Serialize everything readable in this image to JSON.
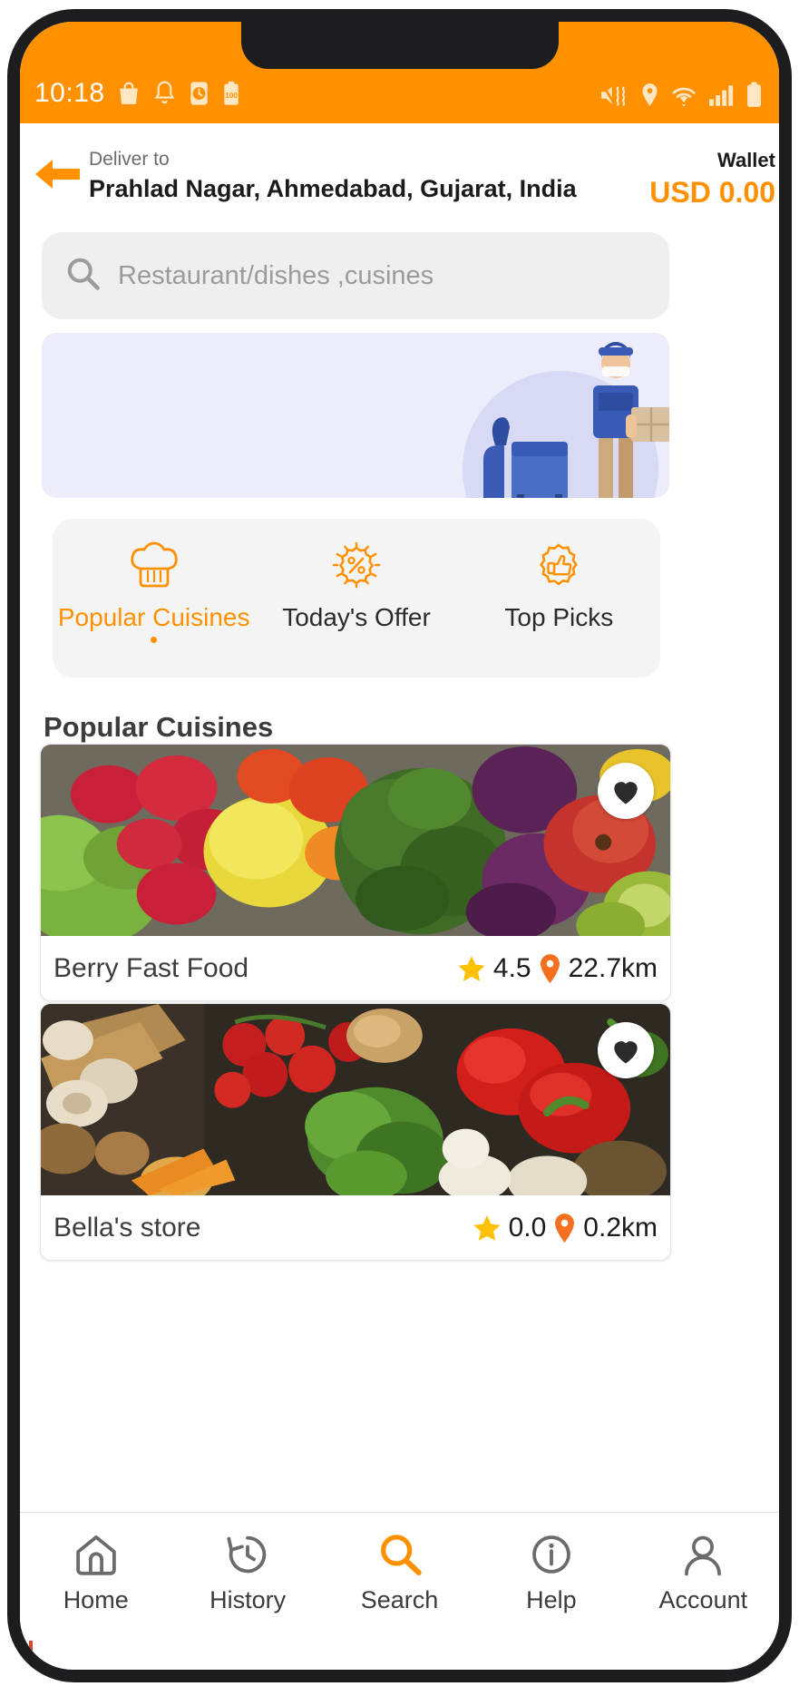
{
  "status_bar": {
    "time": "10:18",
    "left_icons": [
      "shopping-bag-icon",
      "bell-icon",
      "clock-icon",
      "battery-100-icon"
    ],
    "battery_text": "100",
    "right_icons": [
      "volume-mute-vibrate-icon",
      "location-pin-icon",
      "wifi-icon",
      "cellular-signal-icon",
      "battery-full-icon"
    ],
    "bg_color": "#FF9100"
  },
  "header": {
    "back_icon": "arrow-left-icon",
    "deliver_label": "Deliver to",
    "address": "Prahlad Nagar, Ahmedabad, Gujarat, India",
    "wallet_label": "Wallet",
    "wallet_amount": "USD 0.00",
    "accent_color": "#FF9100"
  },
  "search": {
    "icon": "search-icon",
    "placeholder": "Restaurant/dishes ,cusines",
    "value": ""
  },
  "banner": {
    "name": "delivery-person-illustration",
    "bg_color": "#ececfb"
  },
  "category_tabs": {
    "active_index": 0,
    "items": [
      {
        "label": "Popular Cuisines",
        "icon": "chef-hat-icon",
        "active": true
      },
      {
        "label": "Today's Offer",
        "icon": "discount-badge-icon",
        "active": false
      },
      {
        "label": "Top Picks",
        "icon": "thumbs-up-badge-icon",
        "active": false
      }
    ]
  },
  "section": {
    "title": "Popular Cuisines"
  },
  "restaurants": [
    {
      "name": "Berry Fast Food",
      "rating": "4.5",
      "distance": "22.7km",
      "favorite": true,
      "image": "fresh-fruits-vegetables-photo",
      "rating_icon": "star-icon",
      "distance_icon": "location-pin-icon",
      "fav_icon": "heart-icon"
    },
    {
      "name": "Bella's store",
      "rating": "0.0",
      "distance": "0.2km",
      "favorite": true,
      "image": "mushrooms-tomatoes-peppers-photo",
      "rating_icon": "star-icon",
      "distance_icon": "location-pin-icon",
      "fav_icon": "heart-icon"
    }
  ],
  "bottom_nav": {
    "active_index": 2,
    "items": [
      {
        "label": "Home",
        "icon": "home-icon",
        "active": false
      },
      {
        "label": "History",
        "icon": "history-clock-icon",
        "active": false
      },
      {
        "label": "Search",
        "icon": "search-icon",
        "active": true
      },
      {
        "label": "Help",
        "icon": "info-circle-icon",
        "active": false
      },
      {
        "label": "Account",
        "icon": "person-icon",
        "active": false
      }
    ],
    "active_color": "#FF9100"
  }
}
